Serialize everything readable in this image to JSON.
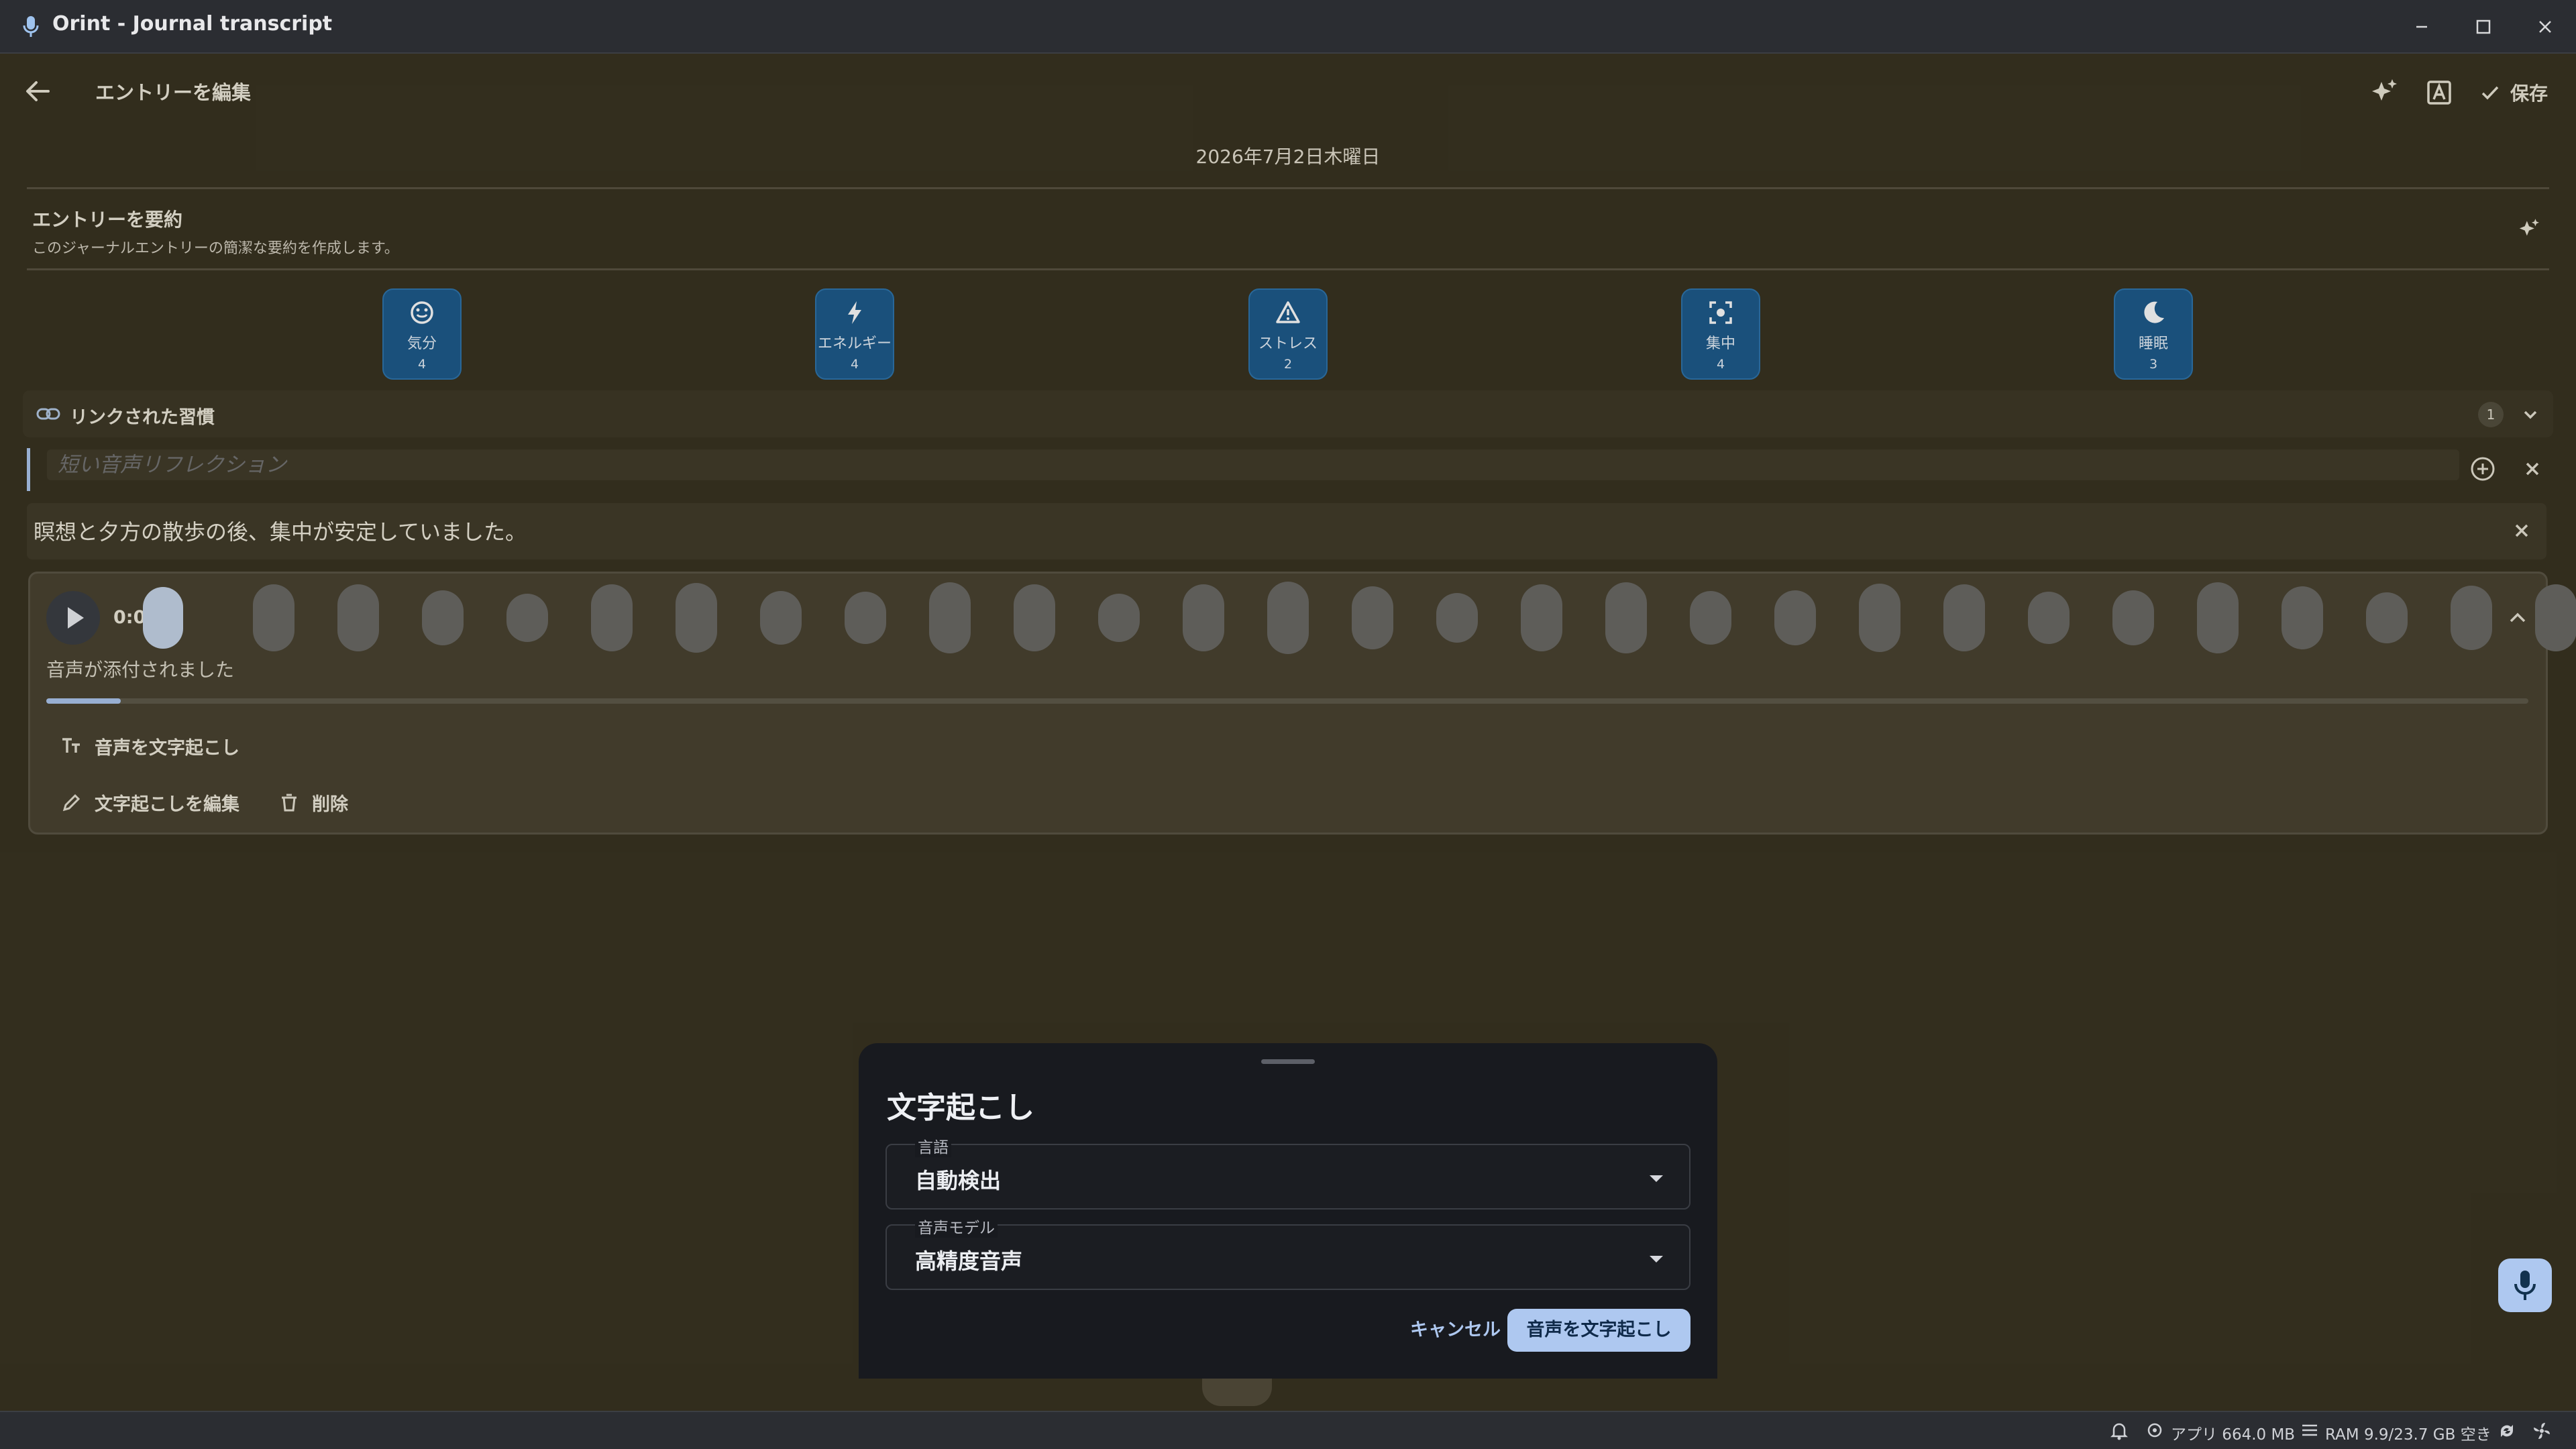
{
  "window": {
    "title": "Orint - Journal transcript",
    "minimize_icon": "minimize-icon",
    "maximize_icon": "maximize-icon",
    "close_icon": "close-icon"
  },
  "appbar": {
    "title": "エントリーを編集",
    "save_label": "保存"
  },
  "date": "2026年7月2日木曜日",
  "summary": {
    "title": "エントリーを要約",
    "description": "このジャーナルエントリーの簡潔な要約を作成します。"
  },
  "metrics": [
    {
      "label": "気分",
      "value": 4,
      "icon": "smile-icon"
    },
    {
      "label": "エネルギー",
      "value": 4,
      "icon": "bolt-icon"
    },
    {
      "label": "ストレス",
      "value": 2,
      "icon": "warning-icon"
    },
    {
      "label": "集中",
      "value": 4,
      "icon": "focus-icon"
    },
    {
      "label": "睡眠",
      "value": 3,
      "icon": "moon-icon"
    }
  ],
  "habits": {
    "label": "リンクされた習慣",
    "count": "1"
  },
  "reflection": {
    "placeholder": "短い音声リフレクション"
  },
  "note": "瞑想と夕方の散歩の後、集中が安定していました。",
  "audio": {
    "time": "0:04",
    "status": "音声が添付されました",
    "progress": 0.03,
    "actions": {
      "transcribe": "音声を文字起こし",
      "edit_transcript": "文字起こしを編集",
      "delete": "削除"
    }
  },
  "sheet": {
    "title": "文字起こし",
    "language": {
      "label": "言語",
      "value": "自動検出"
    },
    "model": {
      "label": "音声モデル",
      "value": "高精度音声"
    },
    "cancel": "キャンセル",
    "confirm": "音声を文字起こし"
  },
  "statusbar": {
    "app_memory": "アプリ 664.0 MB",
    "ram": "RAM 9.9/23.7 GB 空き"
  },
  "colors": {
    "accent": "#aec8f0",
    "tile": "#1e5c8c",
    "background": "#3a3422",
    "sheet": "#181a1f"
  }
}
